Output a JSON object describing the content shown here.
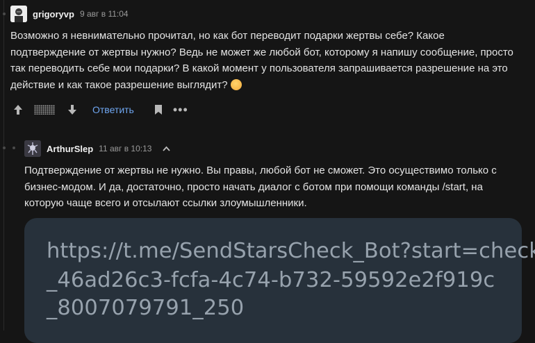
{
  "comments": [
    {
      "username": "grigoryvp",
      "time": "9 авг в 11:04",
      "text_lines": [
        "Возможно я невнимательно прочитал, но как бот переводит подарки жертвы себе? Какое",
        "подтверждение от жертвы нужно? Ведь не может же любой бот, которому я напишу сообщение, просто",
        "так переводить себе мои подарки? В какой момент у пользователя запрашивается разрешение на это",
        "действие и как такое разрешение выглядит?"
      ],
      "emoji": "thinking-face",
      "reply_label": "Ответить"
    },
    {
      "username": "ArthurSlep",
      "time": "11 авг в 10:13",
      "text_lines": [
        "Подтверждение от жертвы не нужно. Вы правы, любой бот не сможет. Это осуществимо только с",
        "бизнес-модом. И да, достаточно, просто начать диалог с ботом при помощи команды /start, на",
        "которую чаще всего и отсылают ссылки злоумышленники."
      ],
      "image_text_lines": [
        "https://t.me/SendStarsCheck_Bot?start=check",
        "_46ad26c3-fcfa-4c74-b732-59592e2f919c",
        "_8007079791_250"
      ]
    }
  ],
  "colors": {
    "background": "#151515",
    "link": "#6fa6f0",
    "code_bg": "#27313b"
  }
}
